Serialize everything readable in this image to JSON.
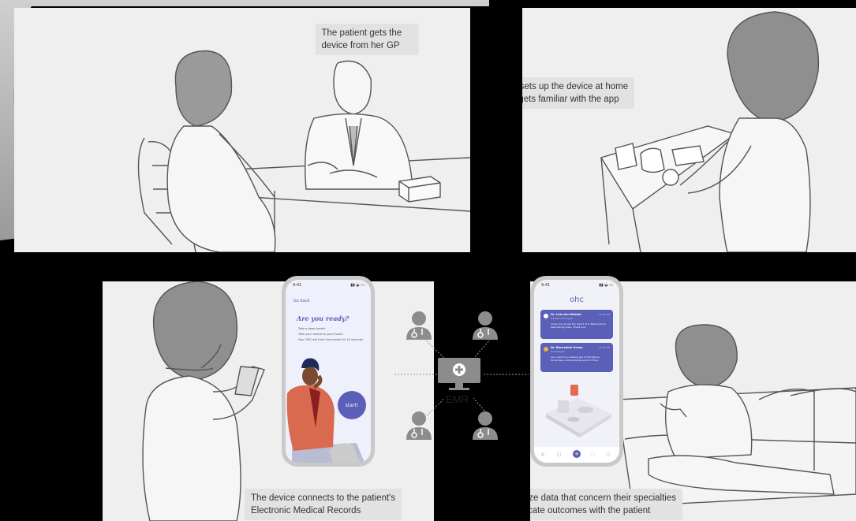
{
  "panels": {
    "p1": {
      "caption": "The patient gets the device from her GP"
    },
    "p2": {
      "caption_line1": "She sets up the device at home",
      "caption_line2": "and gets familiar with the app"
    },
    "p3": {
      "caption_line1": "The device connects to the patient's",
      "caption_line2": "Electronic Medical Records"
    },
    "p4": {
      "caption_line1": "Doctors analyze data that concern their specialties",
      "caption_line2": "and communicate outcomes with the patient"
    }
  },
  "phone_left": {
    "time": "9:41",
    "back": "Go back",
    "heading": "Are you ready?",
    "lines": [
      "Take a deep breath",
      "Take your device to your mouth",
      "Your OHC will track the breath for 10 seconds"
    ],
    "start_button": "start!"
  },
  "emr": {
    "label": "EMR"
  },
  "phone_right": {
    "time": "9:41",
    "logo": "ohc",
    "messages": [
      {
        "name": "Dr. Loïs den Bekker",
        "sub": "Gastroenterologist",
        "time": "12:34 PM",
        "text": "Looks nice to see the report of it. Make sure to keep taking them. Thank you."
      },
      {
        "name": "Dr. Bernadine Kruse",
        "sub": "Cardiologist",
        "time": "12:34 PM",
        "text": "Your report is a reading got of the figures. Some have reduced be prevent on time."
      }
    ]
  },
  "colors": {
    "accent": "#5a5fb8",
    "panel_bg": "#efefef",
    "caption_bg": "#e2e2e2",
    "doctor_gray": "#8c8c8c",
    "coat_orange": "#d9694f"
  }
}
